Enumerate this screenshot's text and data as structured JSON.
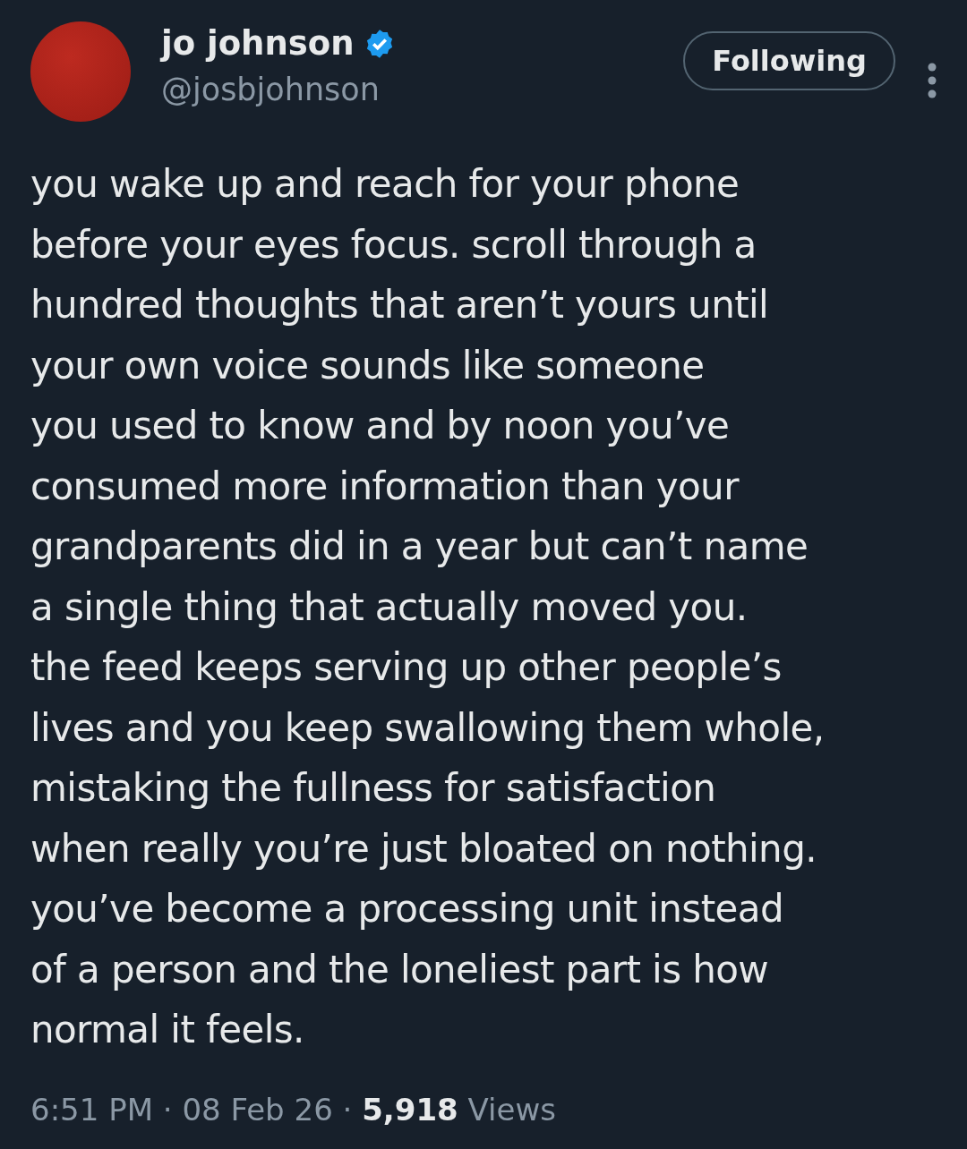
{
  "author": {
    "name": "jo johnson",
    "verified": true,
    "handle": "@josbjohnson"
  },
  "follow_button": {
    "label": "Following"
  },
  "text": "you wake up and reach for your phone\nbefore your eyes focus. scroll through a\nhundred thoughts that aren’t yours until\nyour own voice sounds like someone\nyou used to know and by noon you’ve\nconsumed more information than your\ngrandparents did in a year but can’t name\na single thing that actually moved you.\nthe feed keeps serving up other people’s\nlives and you keep swallowing them whole,\nmistaking the fullness for satisfaction\nwhen really you’re just bloated on nothing.\nyou’ve become a processing unit instead\nof a person and the loneliest part is how\nnormal it feels.",
  "meta": "6:51 PM · 08 Feb 26 · **5,918** Views"
}
